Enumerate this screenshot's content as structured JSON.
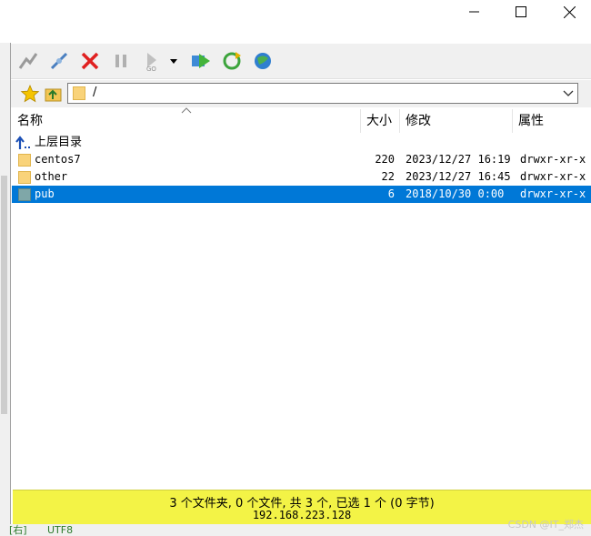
{
  "toolbar": {
    "buttons": [
      "connect-wizard-icon",
      "connect-icon",
      "disconnect-icon",
      "pause-icon",
      "goto-icon",
      "dropdown-arrow-icon",
      "transfer-icon",
      "refresh-icon",
      "globe-icon"
    ]
  },
  "path": {
    "value": "/"
  },
  "columns": {
    "name": "名称",
    "size": "大小",
    "modified": "修改",
    "attr": "属性"
  },
  "parent_dir": "上层目录",
  "files": [
    {
      "name": "centos7",
      "size": "220",
      "modified": "2023/12/27 16:19",
      "attr": "drwxr-xr-x"
    },
    {
      "name": "other",
      "size": "22",
      "modified": "2023/12/27 16:45",
      "attr": "drwxr-xr-x"
    },
    {
      "name": "pub",
      "size": "6",
      "modified": "2018/10/30 0:00",
      "attr": "drwxr-xr-x"
    }
  ],
  "status": {
    "line1": "3 个文件夹, 0 个文件, 共 3 个, 已选 1 个 (0 字节)",
    "line2": "192.168.223.128"
  },
  "bottom": {
    "mode": "[右]",
    "encoding": "UTF8"
  },
  "watermark": "CSDN @IT_郑杰"
}
